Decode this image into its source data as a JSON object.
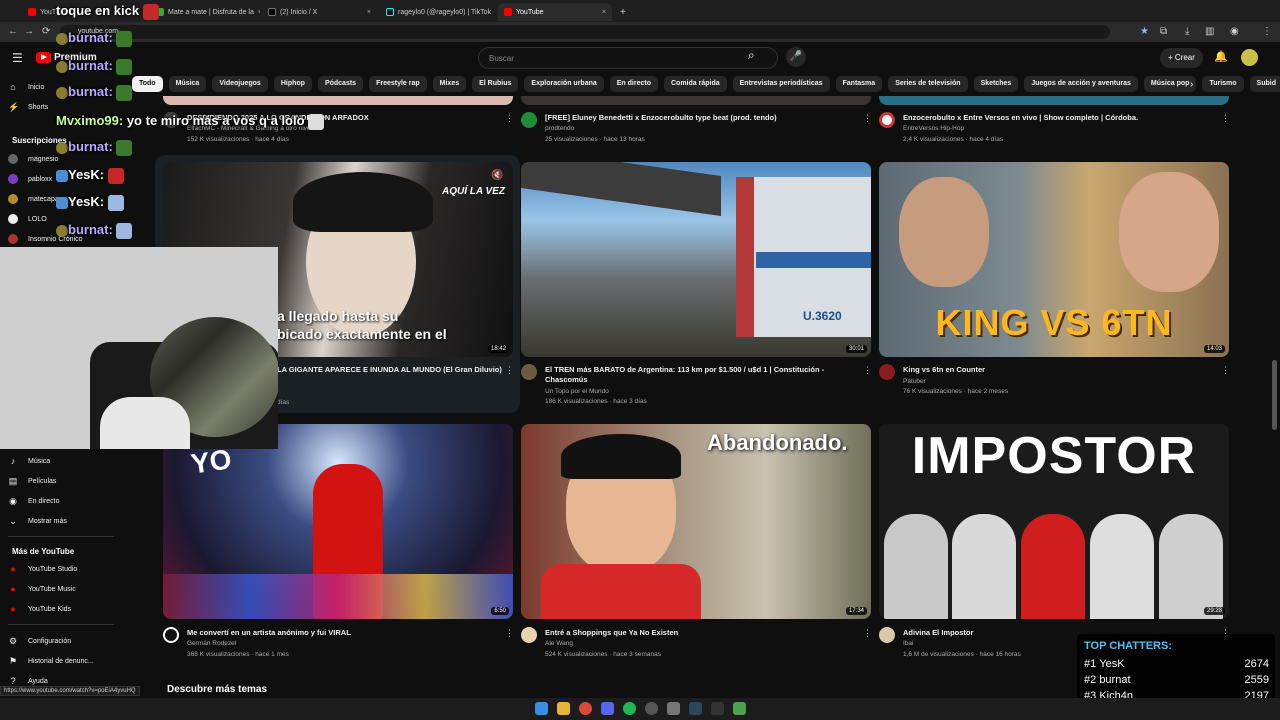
{
  "browser": {
    "tabs": [
      {
        "label": "YouTube"
      },
      {
        "label": "toque en kick"
      },
      {
        "label": "Mate a mate | Disfruta de la"
      },
      {
        "label": "(2) Inicio / X"
      },
      {
        "label": "rageylo0 (@rageylo0) | TikTok"
      },
      {
        "label": "YouTube"
      }
    ],
    "new_tab": "+",
    "url": "youtube.com",
    "status_url": "https://www.youtube.com/watch?v=poEiA4yvuHQ"
  },
  "header": {
    "logo_text": "Premium",
    "search_placeholder": "Buscar",
    "create_label": "+ Crear"
  },
  "chips": [
    "Todo",
    "Música",
    "Videojuegos",
    "Hiphop",
    "Pódcasts",
    "Freestyle rap",
    "Mixes",
    "El Rubius",
    "Exploración urbana",
    "En directo",
    "Comida rápida",
    "Entrevistas periodísticas",
    "Fantasma",
    "Series de televisión",
    "Sketches",
    "Juegos de acción y aventuras",
    "Música pop",
    "Turismo",
    "Subid"
  ],
  "sidebar": {
    "top": [
      {
        "label": "Inicio"
      },
      {
        "label": "Shorts"
      }
    ],
    "subs_header": "Suscripciones",
    "subs": [
      {
        "label": "magnesio"
      },
      {
        "label": "pabloxx"
      },
      {
        "label": "matecapa"
      },
      {
        "label": "LOLO"
      },
      {
        "label": "Insomnio Crónico"
      }
    ],
    "explore": [
      {
        "label": "Música"
      },
      {
        "label": "Películas"
      },
      {
        "label": "En directo"
      },
      {
        "label": "Mostrar más"
      }
    ],
    "more_header": "Más de YouTube",
    "more": [
      {
        "label": "YouTube Studio"
      },
      {
        "label": "YouTube Music"
      },
      {
        "label": "YouTube Kids"
      }
    ],
    "settings": [
      {
        "label": "Configuración"
      },
      {
        "label": "Historial de denunc..."
      },
      {
        "label": "Ayuda"
      }
    ]
  },
  "videos_top": [
    {
      "title": "DESPIDIENDO 2025 A LO GRANDE CON ARFADOX",
      "channel": "ElfachMC - Minecraft & Gaming a otro nivel",
      "meta": "152 K visualizaciones · hace 4 días"
    },
    {
      "title": "[FREE] Eluney Benedetti x Enzocerobulto type beat (prod. tendo)",
      "channel": "prodtendo",
      "meta": "25 visualizaciones · hace 13 horas"
    },
    {
      "title": "Enzocerobulto x Entre Versos en vivo | Show completo | Córdoba.",
      "channel": "EntreVersos Hip-Hop",
      "meta": "2,4 K visualizaciones · hace 4 días"
    }
  ],
  "videos_mid": [
    {
      "title": "LA GIGANTE APARECE E INUNDA AL MUNDO (El Gran Diluvio)",
      "channel": "",
      "meta": "días",
      "duration": "18:42",
      "overlay_text_1": "a llegado hasta su",
      "overlay_text_2": "bicado exactamente en el",
      "tag": "AQUÍ LA VEZ"
    },
    {
      "title": "El TREN más BARATO de Argentina: 113 km por $1.500 / u$d 1 | Constitución - Chascomús",
      "channel": "Un Topo por el Mundo",
      "meta": "186 K visualizaciones · hace 3 días",
      "duration": "30:01",
      "plate": "U.3620"
    },
    {
      "title": "King vs 6tn en Counter",
      "channel": "Patuber",
      "meta": "76 K visualizaciones · hace 2 meses",
      "duration": "14:03",
      "banner": "KING VS 6TN"
    }
  ],
  "videos_bot": [
    {
      "title": "Me convertí en un artista anónimo y fui VIRAL",
      "channel": "Germán Rodezel",
      "meta": "368 K visualizaciones · hace 1 mes",
      "duration": "6:50",
      "overlay": "YO"
    },
    {
      "title": "Entré a Shoppings que Ya No Existen",
      "channel": "Ale Wang",
      "meta": "524 K visualizaciones · hace 3 semanas",
      "duration": "17:34",
      "overlay": "Abandonado."
    },
    {
      "title": "Adivina El Impostor",
      "channel": "Ibai",
      "meta": "1,6 M de visualizaciones · hace 16 horas",
      "duration": "29:28",
      "overlay": "IMPOSTOR"
    }
  ],
  "section_title": "Descubre más temas",
  "stream_chat": [
    {
      "user": "burnat:",
      "msg": ""
    },
    {
      "user": "burnat:",
      "msg": ""
    },
    {
      "user": "burnat:",
      "msg": ""
    },
    {
      "user": "Mvximo99:",
      "msg": "yo te miro más a vos q a lolo"
    },
    {
      "user": "burnat:",
      "msg": ""
    },
    {
      "user": "YesK:",
      "msg": ""
    },
    {
      "user": "YesK:",
      "msg": ""
    },
    {
      "user": "burnat:",
      "msg": ""
    }
  ],
  "stream_header": "toque en kick",
  "top_chatters": {
    "title": "TOP CHATTERS:",
    "rows": [
      {
        "rank": "#1",
        "name": "YesK",
        "count": "2674"
      },
      {
        "rank": "#2",
        "name": "burnat",
        "count": "2559"
      },
      {
        "rank": "#3",
        "name": "Kich4n",
        "count": "2197"
      }
    ]
  },
  "colors": {
    "bg": "#0f0f0f",
    "chip": "#272727",
    "accent_red": "#ff0000",
    "chat_name": "#b9a9ff",
    "chatters_title": "#4fc3f7"
  }
}
